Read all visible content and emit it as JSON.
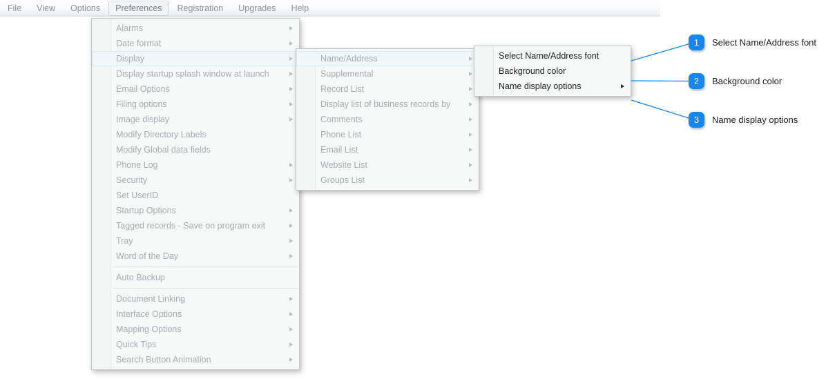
{
  "menubar": {
    "items": [
      {
        "label": "File",
        "active": false
      },
      {
        "label": "View",
        "active": false
      },
      {
        "label": "Options",
        "active": false
      },
      {
        "label": "Preferences",
        "active": true
      },
      {
        "label": "Registration",
        "active": false
      },
      {
        "label": "Upgrades",
        "active": false
      },
      {
        "label": "Help",
        "active": false
      }
    ]
  },
  "menu_preferences": {
    "items": [
      {
        "label": "Alarms",
        "submenu": true
      },
      {
        "label": "Date format",
        "submenu": true
      },
      {
        "label": "Display",
        "submenu": true,
        "selected": true
      },
      {
        "label": "Display startup splash window at launch",
        "submenu": true
      },
      {
        "label": "Email Options",
        "submenu": true
      },
      {
        "label": "Filing options",
        "submenu": true
      },
      {
        "label": "Image display",
        "submenu": true
      },
      {
        "label": "Modify Directory Labels",
        "submenu": false
      },
      {
        "label": "Modify Global data fields",
        "submenu": false
      },
      {
        "label": "Phone Log",
        "submenu": true
      },
      {
        "label": "Security",
        "submenu": true
      },
      {
        "label": "Set UserID",
        "submenu": false
      },
      {
        "label": "Startup Options",
        "submenu": true
      },
      {
        "label": "Tagged records - Save on program exit",
        "submenu": true
      },
      {
        "label": "Tray",
        "submenu": true
      },
      {
        "label": "Word of the Day",
        "submenu": true
      },
      {
        "separator": true
      },
      {
        "label": "Auto Backup",
        "submenu": false
      },
      {
        "separator": true
      },
      {
        "label": "Document Linking",
        "submenu": true
      },
      {
        "label": "Interface Options",
        "submenu": true
      },
      {
        "label": "Mapping Options",
        "submenu": true
      },
      {
        "label": "Quick Tips",
        "submenu": true
      },
      {
        "label": "Search Button Animation",
        "submenu": true
      }
    ]
  },
  "menu_display": {
    "items": [
      {
        "label": "Name/Address",
        "submenu": true,
        "selected": true
      },
      {
        "label": "Supplemental",
        "submenu": true
      },
      {
        "label": "Record List",
        "submenu": true
      },
      {
        "label": "Display list of business records by",
        "submenu": true
      },
      {
        "label": "Comments",
        "submenu": true
      },
      {
        "label": "Phone List",
        "submenu": true
      },
      {
        "label": "Email List",
        "submenu": true
      },
      {
        "label": "Website List",
        "submenu": true
      },
      {
        "label": "Groups List",
        "submenu": true
      }
    ]
  },
  "menu_name_address": {
    "items": [
      {
        "label": "Select Name/Address font",
        "submenu": false
      },
      {
        "label": "Background color",
        "submenu": false
      },
      {
        "label": "Name display options",
        "submenu": true
      }
    ]
  },
  "callouts": {
    "accent_color": "#1686f0",
    "items": [
      {
        "number": "1",
        "label": "Select Name/Address font"
      },
      {
        "number": "2",
        "label": "Background color"
      },
      {
        "number": "3",
        "label": "Name display options"
      }
    ]
  }
}
